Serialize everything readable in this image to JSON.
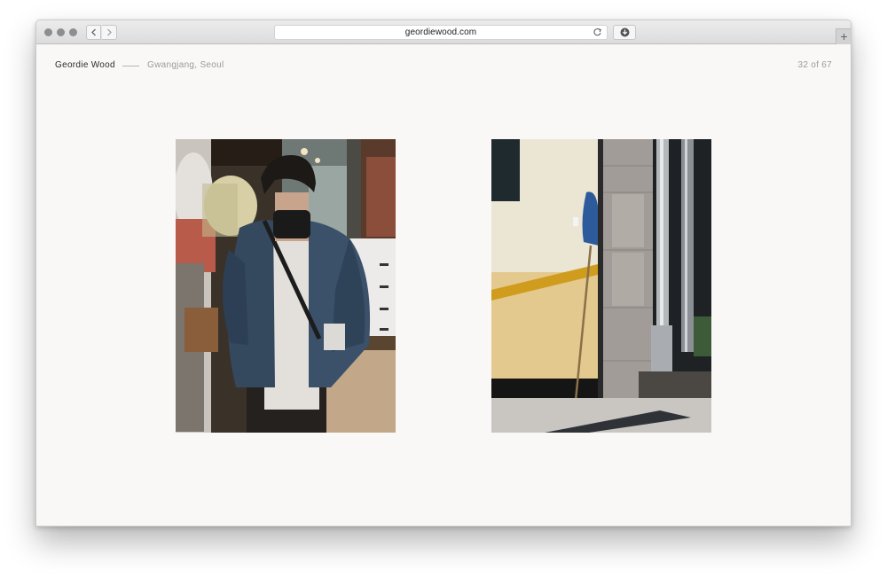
{
  "browser": {
    "address": "geordiewood.com",
    "icons": {
      "back": "chevron-left-icon",
      "forward": "chevron-right-icon",
      "reload": "reload-icon",
      "downloads": "download-icon",
      "new_tab": "plus-icon"
    }
  },
  "site": {
    "name": "Geordie Wood",
    "location": "Gwangjang, Seoul",
    "counter": "32 of 67"
  },
  "colors": {
    "page_background": "#f9f8f6",
    "text_primary": "#2b2b2b",
    "text_muted": "#9a9a9a"
  }
}
